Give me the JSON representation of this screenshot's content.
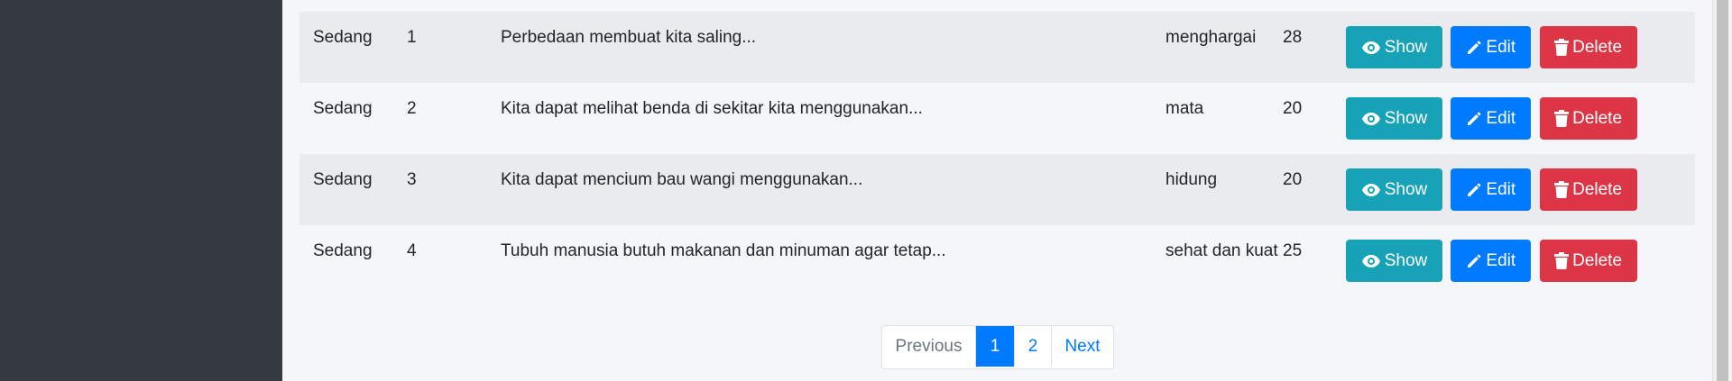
{
  "table": {
    "rows": [
      {
        "level": "Sedang",
        "number": "1",
        "question": "Perbedaan membuat kita saling...",
        "answer": "menghargai",
        "score": "28"
      },
      {
        "level": "Sedang",
        "number": "2",
        "question": "Kita dapat melihat benda di sekitar kita menggunakan...",
        "answer": "mata",
        "score": "20"
      },
      {
        "level": "Sedang",
        "number": "3",
        "question": "Kita dapat mencium bau wangi menggunakan...",
        "answer": "hidung",
        "score": "20"
      },
      {
        "level": "Sedang",
        "number": "4",
        "question": "Tubuh manusia butuh makanan dan minuman agar tetap...",
        "answer": "sehat dan kuat",
        "score": "25"
      }
    ],
    "actions": {
      "show": "Show",
      "edit": "Edit",
      "delete": "Delete"
    }
  },
  "pagination": {
    "previous": "Previous",
    "pages": [
      "1",
      "2"
    ],
    "active_page": "1",
    "next": "Next"
  },
  "colors": {
    "sidebar": "#343a40",
    "show": "#17a2b8",
    "edit": "#007bff",
    "delete": "#dc3545",
    "active_page": "#007bff"
  },
  "icons": {
    "show": "eye-icon",
    "edit": "pencil-icon",
    "delete": "trash-icon"
  }
}
